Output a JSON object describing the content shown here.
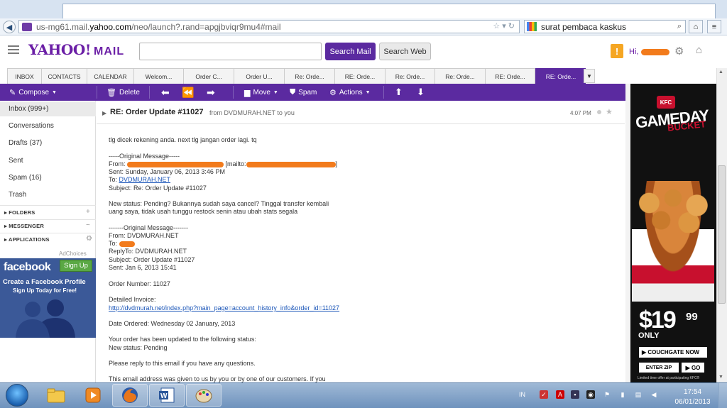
{
  "browser": {
    "url_prefix": "us-mg61.mail.",
    "url_domain": "yahoo.com",
    "url_suffix": "/neo/launch?.rand=apgjbviqr9mu4#mail",
    "search_query": "surat pembaca kaskus"
  },
  "yahoo": {
    "logo": "YAHOO!",
    "logo_mail": "MAIL",
    "search_placeholder": "",
    "search_mail_label": "Search Mail",
    "search_web_label": "Search Web",
    "greeting": "Hi,"
  },
  "tabs": [
    {
      "label": "INBOX",
      "active": false
    },
    {
      "label": "CONTACTS",
      "active": false
    },
    {
      "label": "CALENDAR",
      "active": false
    },
    {
      "label": "Welcom...",
      "active": false
    },
    {
      "label": "Order C...",
      "active": false
    },
    {
      "label": "Order U...",
      "active": false
    },
    {
      "label": "Re: Orde...",
      "active": false
    },
    {
      "label": "RE: Orde...",
      "active": false
    },
    {
      "label": "Re: Orde...",
      "active": false
    },
    {
      "label": "Re: Orde...",
      "active": false
    },
    {
      "label": "RE: Orde...",
      "active": false
    },
    {
      "label": "RE: Orde...",
      "active": true
    }
  ],
  "toolbar": {
    "compose": "Compose",
    "delete": "Delete",
    "move": "Move",
    "spam": "Spam",
    "actions": "Actions"
  },
  "sidebar": {
    "items": [
      {
        "label": "Inbox (999+)"
      },
      {
        "label": "Conversations"
      },
      {
        "label": "Drafts (37)"
      },
      {
        "label": "Sent"
      },
      {
        "label": "Spam (16)"
      },
      {
        "label": "Trash"
      }
    ],
    "sections": [
      {
        "label": "FOLDERS"
      },
      {
        "label": "MESSENGER"
      },
      {
        "label": "APPLICATIONS"
      }
    ],
    "adchoices": "AdChoices"
  },
  "facebook_ad": {
    "logo": "facebook",
    "signup": "Sign Up",
    "line1": "Create a Facebook Profile",
    "line2": "Sign Up Today for Free!"
  },
  "message": {
    "subject": "RE: Order Update #11027",
    "from_line": "from DVDMURAH.NET to you",
    "time": "4:07 PM",
    "intro": "tlg dicek rekening anda. next tlg jangan order lagi. tq",
    "orig1_header": "-----Original Message-----",
    "from_label": "From:",
    "mailto_label": "[mailto:",
    "mailto_close": "]",
    "sent1": "Sent: Sunday, January 06, 2013 3:46 PM",
    "to_label": "To:",
    "to_link": "DVDMURAH.NET",
    "subject1": "Subject: Re: Order Update #11027",
    "status_line1": "New status: Pending? Bukannya sudah saya cancel? Tinggal transfer kembali",
    "status_line2": "uang saya, tidak usah tunggu restock senin atau ubah stats segala",
    "orig2_header": "-------Original Message-------",
    "from2": "From: DVDMURAH.NET",
    "to2_label": "To:",
    "replyto": "ReplyTo: DVDMURAH.NET",
    "subject2": "Subject: Order Update #11027",
    "sent2": "Sent: Jan 6, 2013 15:41",
    "order_number": "Order Number: 11027",
    "invoice_label": "Detailed Invoice:",
    "invoice_link": "http://dvdmurah.net/index.php?main_page=account_history_info&order_id=11027",
    "date_ordered": "Date Ordered: Wednesday 02 January, 2013",
    "updated_line": "Your order has been updated to the following status:",
    "new_status": "New status: Pending",
    "reply_line": "Please reply to this email if you have any questions.",
    "given_line": "This email address was given to us by you or by one of our customers. If you"
  },
  "kfc_ad": {
    "badge": "KFC",
    "title1": "GAMEDAY",
    "title2": "BUCKET",
    "price": "$19",
    "cents": "99",
    "only": "ONLY",
    "couchgate": "▶ COUCHGATE NOW",
    "enter_zip": "ENTER ZIP",
    "go": "▶ GO",
    "fine": "Limited time offer at participating KFC®"
  },
  "taskbar": {
    "lang": "IN",
    "time": "17:54",
    "date": "06/01/2013"
  }
}
